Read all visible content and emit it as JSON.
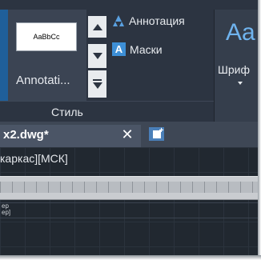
{
  "ribbon": {
    "style_panel": {
      "swatch_text": "AaBbCc",
      "current_style_label": "Annotati...",
      "title": "Стиль",
      "items": [
        {
          "icon": "annotation-scale-icon",
          "label": "Аннотация"
        },
        {
          "icon": "mask-icon",
          "label": "Маски"
        }
      ],
      "mask_icon_letter": "A"
    },
    "font_panel": {
      "preview": "Aa",
      "label": "Шриф"
    },
    "colors": {
      "accent": "#3d8fd6",
      "preview": "#6fb3ee",
      "background": "#2c3441"
    }
  },
  "tabs": {
    "active": {
      "label": "x2.dwg*",
      "close_symbol": "✕"
    },
    "new_tab_icon": "new-tab-icon"
  },
  "viewport": {
    "label": "каркас][МСК]",
    "row_labels": [
      "ер",
      "ер]"
    ]
  }
}
